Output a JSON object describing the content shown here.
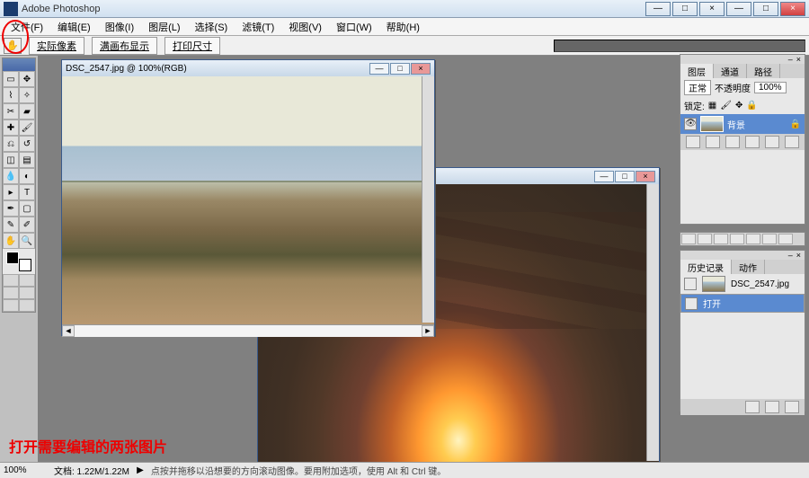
{
  "app": {
    "title": "Adobe Photoshop"
  },
  "menus": [
    "文件(F)",
    "编辑(E)",
    "图像(I)",
    "图层(L)",
    "选择(S)",
    "滤镜(T)",
    "视图(V)",
    "窗口(W)",
    "帮助(H)"
  ],
  "optbar": {
    "btn1": "实际像素",
    "btn2": "满画布显示",
    "btn3": "打印尺寸"
  },
  "doc1": {
    "title": "DSC_2547.jpg @ 100%(RGB)"
  },
  "layers": {
    "tabs": [
      "图层",
      "通道",
      "路径"
    ],
    "blend": "正常",
    "opacity_label": "不透明度",
    "opacity": "100%",
    "lock_label": "锁定:",
    "layer_name": "背景"
  },
  "history": {
    "tabs": [
      "历史记录",
      "动作"
    ],
    "snapshot": "DSC_2547.jpg",
    "step1": "打开"
  },
  "annotation": "打开需要编辑的两张图片",
  "status": {
    "zoom": "100%",
    "doc": "文档: 1.22M/1.22M",
    "hint": "点按并拖移以沿想要的方向滚动图像。要用附加选项，使用 Alt 和 Ctrl 键。"
  },
  "icons": {
    "hand": "✋",
    "min": "—",
    "max": "□",
    "close": "×",
    "left": "◄",
    "right": "►",
    "up": "▲",
    "down": "▼",
    "eye": "👁",
    "lock": "🔒"
  }
}
